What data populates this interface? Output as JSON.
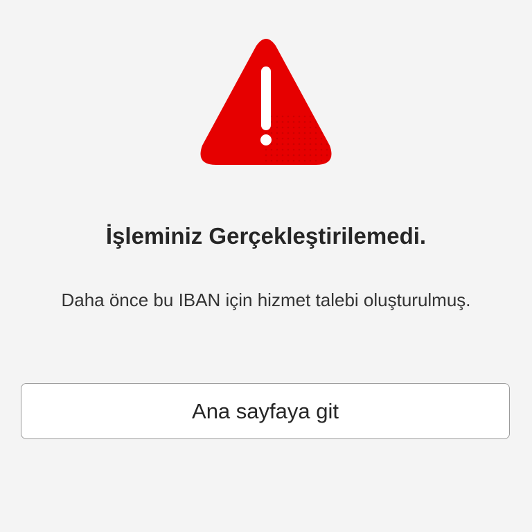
{
  "icons": {
    "warning": "warning-triangle-icon"
  },
  "colors": {
    "background": "#f4f4f4",
    "accent_red": "#e60000",
    "text_primary": "#262626",
    "button_border": "#9b9b9b"
  },
  "error": {
    "title": "İşleminiz Gerçekleştirilemedi.",
    "message": "Daha önce bu IBAN için hizmet talebi oluşturulmuş."
  },
  "actions": {
    "home_button_label": "Ana sayfaya git"
  }
}
